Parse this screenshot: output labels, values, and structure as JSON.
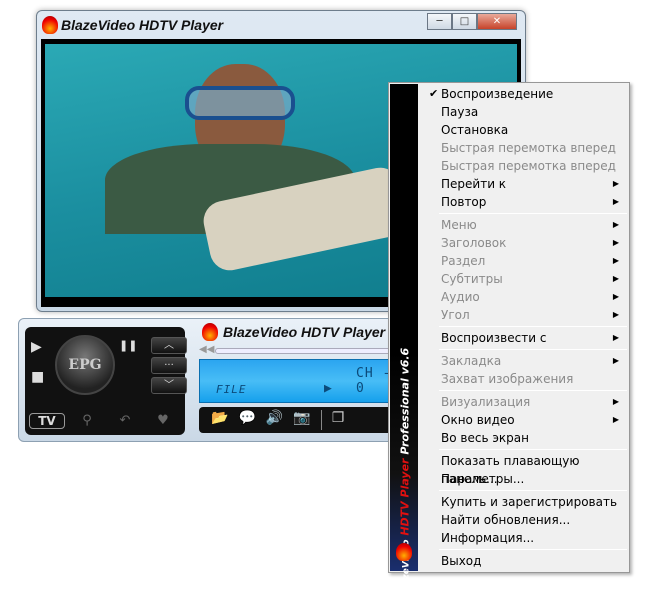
{
  "window": {
    "title": "BlazeVideo HDTV Player",
    "minimize": "─",
    "maximize": "□",
    "close": "✕"
  },
  "controls": {
    "play": "▶",
    "pause": "❚❚",
    "stop": "■",
    "epg": "EPG",
    "up": "︿",
    "more": "···",
    "down": "﹀",
    "tv": "TV",
    "title": "BlazeVideo HDTV Player",
    "lcd_file": "FILE",
    "lcd_play": "▶",
    "lcd_channel": "CH - 0"
  },
  "menu": {
    "sidebar_brand": "BlazeVideo",
    "sidebar_product": "HDTV Player",
    "sidebar_edition": "Professional v6.6",
    "groups": [
      [
        {
          "label": "Воспроизведение",
          "checked": true
        },
        {
          "label": "Пауза"
        },
        {
          "label": "Остановка"
        },
        {
          "label": "Быстрая перемотка вперед",
          "disabled": true
        },
        {
          "label": "Быстрая перемотка вперед",
          "disabled": true
        },
        {
          "label": "Перейти к",
          "submenu": true
        },
        {
          "label": "Повтор",
          "submenu": true
        }
      ],
      [
        {
          "label": "Меню",
          "disabled": true,
          "submenu": true
        },
        {
          "label": "Заголовок",
          "disabled": true,
          "submenu": true
        },
        {
          "label": "Раздел",
          "disabled": true,
          "submenu": true
        },
        {
          "label": "Субтитры",
          "disabled": true,
          "submenu": true
        },
        {
          "label": "Аудио",
          "disabled": true,
          "submenu": true
        },
        {
          "label": "Угол",
          "disabled": true,
          "submenu": true
        }
      ],
      [
        {
          "label": "Воспроизвести с",
          "submenu": true
        }
      ],
      [
        {
          "label": "Закладка",
          "disabled": true,
          "submenu": true
        },
        {
          "label": "Захват изображения",
          "disabled": true
        }
      ],
      [
        {
          "label": "Визуализация",
          "disabled": true,
          "submenu": true
        },
        {
          "label": "Окно видео",
          "submenu": true
        },
        {
          "label": "Во весь экран"
        }
      ],
      [
        {
          "label": "Показать плавающую панель..."
        },
        {
          "label": "Параметры..."
        }
      ],
      [
        {
          "label": "Купить и зарегистрировать"
        },
        {
          "label": "Найти обновления..."
        },
        {
          "label": "Информация..."
        }
      ],
      [
        {
          "label": "Выход"
        }
      ]
    ]
  }
}
